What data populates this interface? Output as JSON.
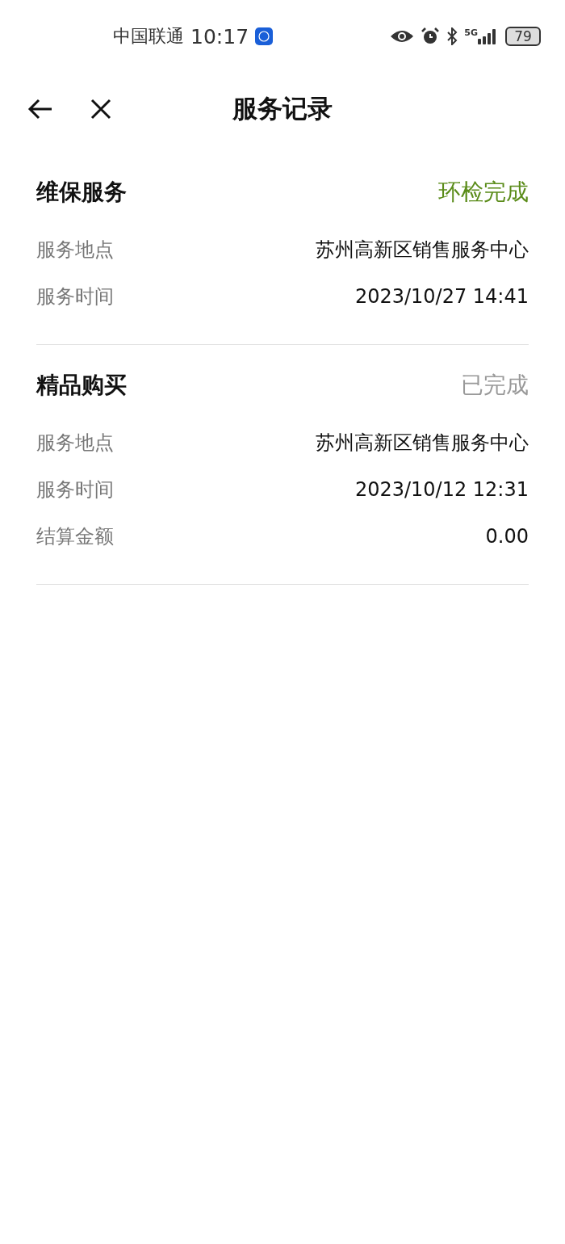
{
  "status_bar": {
    "carrier": "中国联通",
    "time": "10:17",
    "network": "5G",
    "battery": "79"
  },
  "header": {
    "title": "服务记录"
  },
  "records": [
    {
      "title": "维保服务",
      "status": "环检完成",
      "color": "#5b8c1a",
      "fields": [
        {
          "label": "服务地点",
          "value": "苏州高新区销售服务中心"
        },
        {
          "label": "服务时间",
          "value": "2023/10/27 14:41"
        }
      ]
    },
    {
      "title": "精品购买",
      "status": "已完成",
      "color": "#999999",
      "fields": [
        {
          "label": "服务地点",
          "value": "苏州高新区销售服务中心"
        },
        {
          "label": "服务时间",
          "value": "2023/10/12 12:31"
        },
        {
          "label": "结算金额",
          "value": "0.00"
        }
      ]
    }
  ]
}
